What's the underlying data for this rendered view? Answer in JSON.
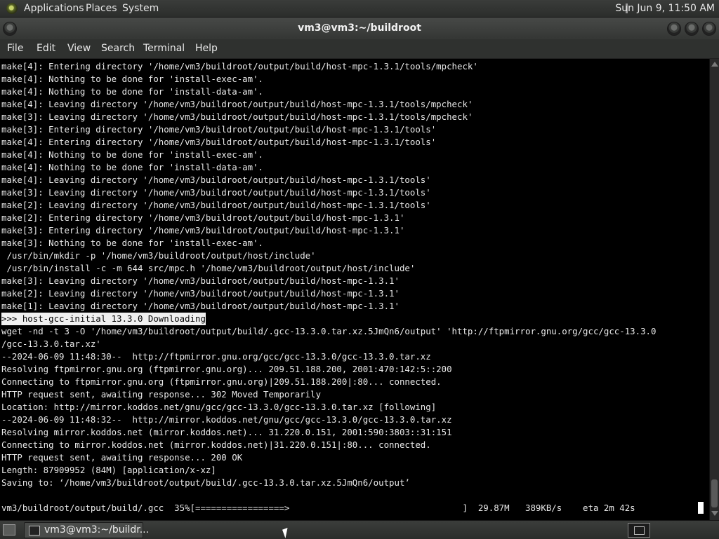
{
  "panel": {
    "menus": [
      "Applications",
      "Places",
      "System"
    ],
    "clock": "Sun Jun  9, 11:50 AM"
  },
  "window": {
    "title": "vm3@vm3:~/buildroot"
  },
  "menubar": [
    "File",
    "Edit",
    "View",
    "Search",
    "Terminal",
    "Help"
  ],
  "terminal": {
    "lines": [
      "make[4]: Entering directory '/home/vm3/buildroot/output/build/host-mpc-1.3.1/tools/mpcheck'",
      "make[4]: Nothing to be done for 'install-exec-am'.",
      "make[4]: Nothing to be done for 'install-data-am'.",
      "make[4]: Leaving directory '/home/vm3/buildroot/output/build/host-mpc-1.3.1/tools/mpcheck'",
      "make[3]: Leaving directory '/home/vm3/buildroot/output/build/host-mpc-1.3.1/tools/mpcheck'",
      "make[3]: Entering directory '/home/vm3/buildroot/output/build/host-mpc-1.3.1/tools'",
      "make[4]: Entering directory '/home/vm3/buildroot/output/build/host-mpc-1.3.1/tools'",
      "make[4]: Nothing to be done for 'install-exec-am'.",
      "make[4]: Nothing to be done for 'install-data-am'.",
      "make[4]: Leaving directory '/home/vm3/buildroot/output/build/host-mpc-1.3.1/tools'",
      "make[3]: Leaving directory '/home/vm3/buildroot/output/build/host-mpc-1.3.1/tools'",
      "make[2]: Leaving directory '/home/vm3/buildroot/output/build/host-mpc-1.3.1/tools'",
      "make[2]: Entering directory '/home/vm3/buildroot/output/build/host-mpc-1.3.1'",
      "make[3]: Entering directory '/home/vm3/buildroot/output/build/host-mpc-1.3.1'",
      "make[3]: Nothing to be done for 'install-exec-am'.",
      " /usr/bin/mkdir -p '/home/vm3/buildroot/output/host/include'",
      " /usr/bin/install -c -m 644 src/mpc.h '/home/vm3/buildroot/output/host/include'",
      "make[3]: Leaving directory '/home/vm3/buildroot/output/build/host-mpc-1.3.1'",
      "make[2]: Leaving directory '/home/vm3/buildroot/output/build/host-mpc-1.3.1'",
      "make[1]: Leaving directory '/home/vm3/buildroot/output/build/host-mpc-1.3.1'",
      ">>> host-gcc-initial 13.3.0 Downloading",
      "wget -nd -t 3 -O '/home/vm3/buildroot/output/build/.gcc-13.3.0.tar.xz.5JmQn6/output' 'http://ftpmirror.gnu.org/gcc/gcc-13.3.0",
      "/gcc-13.3.0.tar.xz'",
      "--2024-06-09 11:48:30--  http://ftpmirror.gnu.org/gcc/gcc-13.3.0/gcc-13.3.0.tar.xz",
      "Resolving ftpmirror.gnu.org (ftpmirror.gnu.org)... 209.51.188.200, 2001:470:142:5::200",
      "Connecting to ftpmirror.gnu.org (ftpmirror.gnu.org)|209.51.188.200|:80... connected.",
      "HTTP request sent, awaiting response... 302 Moved Temporarily",
      "Location: http://mirror.koddos.net/gnu/gcc/gcc-13.3.0/gcc-13.3.0.tar.xz [following]",
      "--2024-06-09 11:48:32--  http://mirror.koddos.net/gnu/gcc/gcc-13.3.0/gcc-13.3.0.tar.xz",
      "Resolving mirror.koddos.net (mirror.koddos.net)... 31.220.0.151, 2001:590:3803::31:151",
      "Connecting to mirror.koddos.net (mirror.koddos.net)|31.220.0.151|:80... connected.",
      "HTTP request sent, awaiting response... 200 OK",
      "Length: 87909952 (84M) [application/x-xz]",
      "Saving to: ‘/home/vm3/buildroot/output/build/.gcc-13.3.0.tar.xz.5JmQn6/output’",
      "",
      "vm3/buildroot/output/build/.gcc  35%[=================>                                 ]  29.87M   389KB/s    eta 2m 42s  "
    ],
    "highlight_index": 20
  },
  "taskbar": {
    "task_label": "vm3@vm3:~/buildr..."
  }
}
